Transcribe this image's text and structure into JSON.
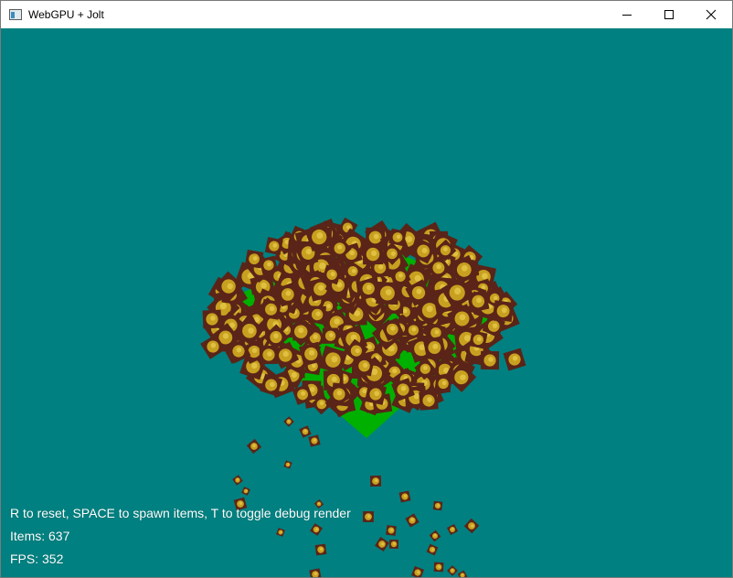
{
  "window": {
    "title": "WebGPU + Jolt",
    "controls": {
      "minimize_icon": "minimize-icon",
      "maximize_icon": "maximize-icon",
      "close_icon": "close-icon"
    }
  },
  "scene": {
    "background_color": "#008080",
    "floor_color": "#00b000",
    "box_dark_color": "#5a2418",
    "box_face_color": "#c8a020",
    "box_accent_color": "#e0c040"
  },
  "hud": {
    "instructions": "R to reset, SPACE to spawn items, T to toggle debug render",
    "items_text": "Items: 637",
    "fps_text": "FPS: 352"
  }
}
